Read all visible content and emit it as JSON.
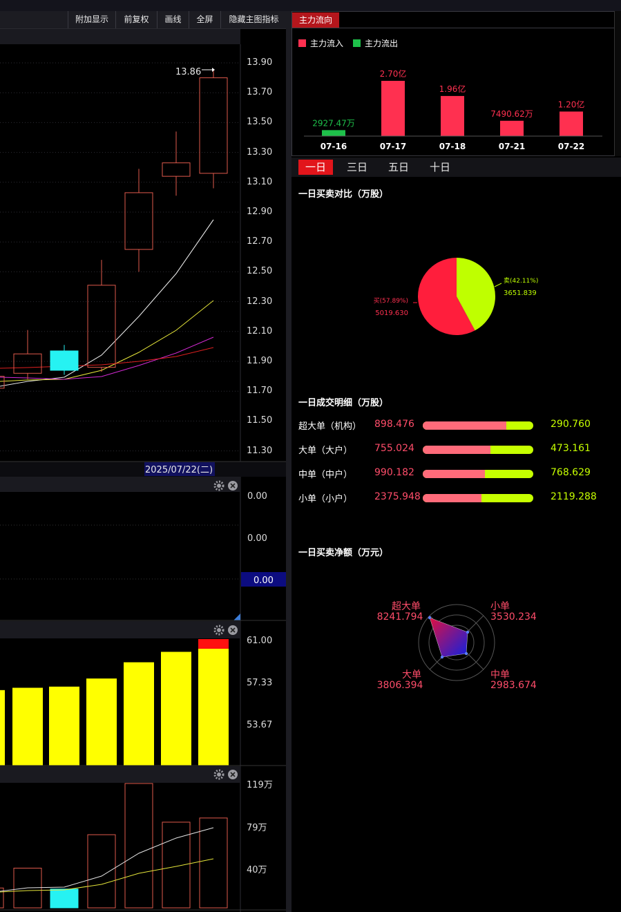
{
  "toolbar": {
    "items": [
      "附加显示",
      "前复权",
      "画线",
      "全屏",
      "隐藏主图指标"
    ]
  },
  "main_chart": {
    "price_labels": [
      "13.90",
      "13.70",
      "13.50",
      "13.30",
      "13.10",
      "12.90",
      "12.70",
      "12.50",
      "12.30",
      "12.10",
      "11.90",
      "11.70",
      "11.50",
      "11.30"
    ],
    "high_marker": "13.86",
    "date_label": "2025/07/22(二)",
    "candles": [
      {
        "open": 11.95,
        "close": 11.82,
        "high": 12.11,
        "low": 11.78,
        "color": "up"
      },
      {
        "open": 11.84,
        "close": 11.97,
        "high": 12.01,
        "low": 11.81,
        "color": "down"
      },
      {
        "open": 11.86,
        "close": 12.41,
        "high": 12.58,
        "low": 11.83,
        "color": "up"
      },
      {
        "open": 12.65,
        "close": 13.03,
        "high": 13.19,
        "low": 12.5,
        "color": "up"
      },
      {
        "open": 13.14,
        "close": 13.23,
        "high": 13.44,
        "low": 13.01,
        "color": "up"
      },
      {
        "open": 13.16,
        "close": 13.8,
        "high": 13.86,
        "low": 13.06,
        "color": "up"
      }
    ]
  },
  "indicator1": {
    "labels": [
      "0.00",
      "0.00"
    ],
    "current": "0.00"
  },
  "indicator2": {
    "labels": [
      "61.00",
      "57.33",
      "53.67"
    ],
    "bars": [
      56.6,
      56.8,
      56.9,
      57.6,
      59.0,
      59.9,
      61.0
    ]
  },
  "volume": {
    "labels": [
      "119万",
      "79万",
      "40万"
    ],
    "bars": [
      19,
      38,
      18,
      70,
      119,
      82,
      86
    ]
  },
  "flow": {
    "tab": "主力流向",
    "legend_in": "主力流入",
    "legend_out": "主力流出",
    "color_in": "#ff3050",
    "color_out": "#1ec14a",
    "bars": [
      {
        "date": "07-16",
        "label": "2927.47万",
        "value": 0.2927,
        "dir": "out"
      },
      {
        "date": "07-17",
        "label": "2.70亿",
        "value": 2.7,
        "dir": "in"
      },
      {
        "date": "07-18",
        "label": "1.96亿",
        "value": 1.96,
        "dir": "in"
      },
      {
        "date": "07-21",
        "label": "7490.62万",
        "value": 0.749,
        "dir": "in"
      },
      {
        "date": "07-22",
        "label": "1.20亿",
        "value": 1.2,
        "dir": "in"
      }
    ]
  },
  "periods": {
    "tabs": [
      "一日",
      "三日",
      "五日",
      "十日"
    ],
    "active": 0
  },
  "pie": {
    "title": "一日买卖对比（万股）",
    "buy_label": "买(57.89%)",
    "buy_value": "5019.630",
    "buy_pct": 57.89,
    "sell_label": "卖(42.11%)",
    "sell_value": "3651.839",
    "sell_pct": 42.11
  },
  "details": {
    "title": "一日成交明细（万股）",
    "rows": [
      {
        "label": "超大单（机构）",
        "buy": "898.476",
        "sell": "290.760",
        "ratio": 0.756
      },
      {
        "label": "大单（大户）",
        "buy": "755.024",
        "sell": "473.161",
        "ratio": 0.615
      },
      {
        "label": "中单（中户）",
        "buy": "990.182",
        "sell": "768.629",
        "ratio": 0.563
      },
      {
        "label": "小单（小户）",
        "buy": "2375.948",
        "sell": "2119.288",
        "ratio": 0.529
      }
    ]
  },
  "radar": {
    "title": "一日买卖净额（万元）",
    "items": [
      {
        "name": "超大单",
        "value": "8241.794"
      },
      {
        "name": "小单",
        "value": "3530.234"
      },
      {
        "name": "中单",
        "value": "2983.674"
      },
      {
        "name": "大单",
        "value": "3806.394"
      }
    ]
  }
}
